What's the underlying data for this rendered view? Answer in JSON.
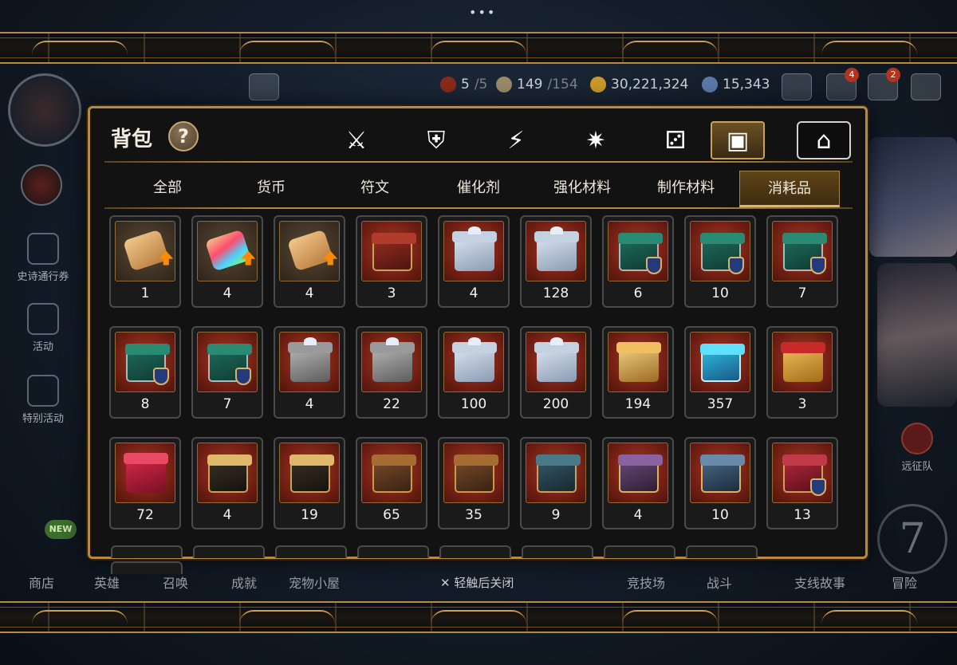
{
  "top_resources": {
    "stamina": {
      "current": "5",
      "max": "/5"
    },
    "capacity": {
      "current": "149",
      "max": "/154"
    },
    "gold": "30,221,324",
    "gems": "15,343"
  },
  "hud_badges": {
    "mail": "4",
    "chat": "2"
  },
  "side_menu": {
    "epic_pass": "史诗通行券",
    "event": "活动",
    "special_event": "特别活动",
    "expedition": "远征队"
  },
  "bottom_nav": {
    "shop": "商店",
    "new_badge": "NEW",
    "heroes": "英雄",
    "summon": "召唤",
    "achievements": "成就",
    "pet_house": "宠物小屋",
    "arena": "竞技场",
    "battle": "战斗",
    "side_story": "支线故事",
    "adventure": "冒险",
    "adventure_number": "7"
  },
  "close_hint": "轻触后关闭",
  "panel": {
    "title": "背包",
    "help": "?",
    "category_tabs": [
      {
        "icon": "weapon-armor-icon",
        "glyph": "⚔"
      },
      {
        "icon": "broken-shield-icon",
        "glyph": "⛨"
      },
      {
        "icon": "lightning-icon",
        "glyph": "⚡"
      },
      {
        "icon": "burst-icon",
        "glyph": "✷"
      },
      {
        "icon": "dice-icon",
        "glyph": "⚂"
      },
      {
        "icon": "bag-icon",
        "glyph": "▣",
        "selected": true
      },
      {
        "icon": "house-icon",
        "glyph": "⌂",
        "outlined": true
      }
    ],
    "sub_tabs": [
      "全部",
      "货币",
      "符文",
      "催化剂",
      "强化材料",
      "制作材料",
      "消耗品"
    ],
    "selected_sub_tab": "消耗品"
  },
  "items": [
    {
      "type": "scroll-up",
      "qty": "1"
    },
    {
      "type": "scroll-rainbow",
      "qty": "4"
    },
    {
      "type": "scroll-up",
      "qty": "4"
    },
    {
      "type": "chest-red",
      "qty": "3"
    },
    {
      "type": "silver-box",
      "qty": "4"
    },
    {
      "type": "silver-box",
      "qty": "128"
    },
    {
      "type": "green-box-arrow",
      "qty": "6"
    },
    {
      "type": "green-box-sword",
      "qty": "10"
    },
    {
      "type": "green-box-drop",
      "qty": "7"
    },
    {
      "type": "green-box-claw",
      "qty": "8"
    },
    {
      "type": "green-box-shield",
      "qty": "7"
    },
    {
      "type": "iron-box",
      "qty": "4"
    },
    {
      "type": "iron-box",
      "qty": "22"
    },
    {
      "type": "silver-box",
      "qty": "100"
    },
    {
      "type": "silver-box",
      "qty": "200"
    },
    {
      "type": "gold-chest",
      "qty": "194"
    },
    {
      "type": "blue-chest",
      "qty": "357"
    },
    {
      "type": "gift-box",
      "qty": "3"
    },
    {
      "type": "red-gift-box",
      "qty": "72"
    },
    {
      "type": "dark-house-box",
      "qty": "4"
    },
    {
      "type": "dark-house-box",
      "qty": "19"
    },
    {
      "type": "brown-chest",
      "qty": "65"
    },
    {
      "type": "brown-chest",
      "qty": "35"
    },
    {
      "type": "teal-cube",
      "qty": "9"
    },
    {
      "type": "purple-cube",
      "qty": "4"
    },
    {
      "type": "navy-chest",
      "qty": "10"
    },
    {
      "type": "red-box-sword",
      "qty": "13"
    }
  ]
}
